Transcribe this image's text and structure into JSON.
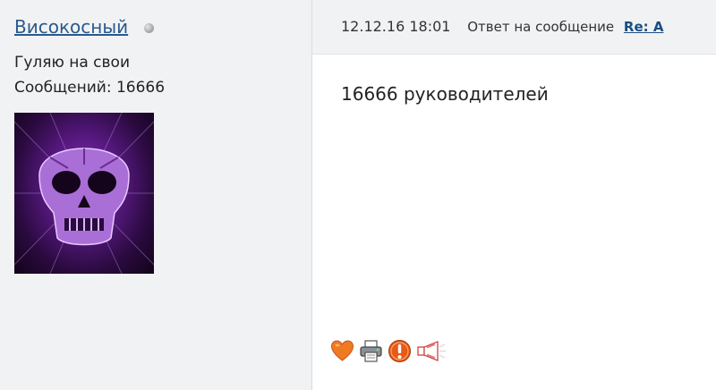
{
  "author": {
    "username": "Високосный",
    "online_status": "offline",
    "status_text": "Гуляю на свои",
    "posts_label": "Сообщений:",
    "posts_count": "16666",
    "avatar_icon": "purple-skull-avatar"
  },
  "message": {
    "date": "12.12.16 18:01",
    "reply_label": "Ответ на сообщение",
    "thread_link": "Re: A",
    "text": "16666 руководителей"
  },
  "actions": [
    {
      "icon": "heart-icon"
    },
    {
      "icon": "printer-icon"
    },
    {
      "icon": "warning-icon"
    },
    {
      "icon": "megaphone-icon"
    }
  ],
  "colors": {
    "panel_bg": "#f1f2f4",
    "link": "#2a5a8c",
    "thread_link": "#1b4e80",
    "heart": "#f07a22",
    "warning": "#e85a17"
  }
}
